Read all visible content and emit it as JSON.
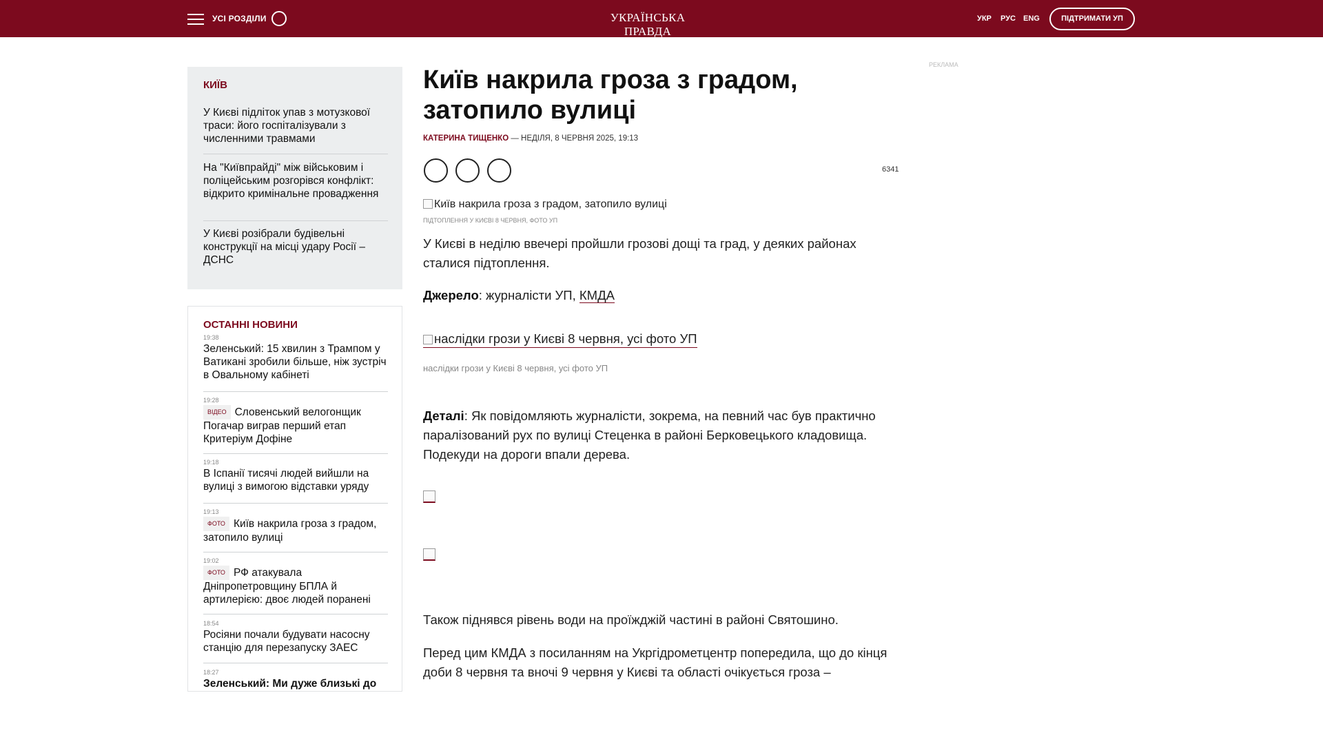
{
  "header": {
    "sections_label": "УСІ РОЗДІЛИ",
    "logo": "УКРАЇНСЬКА ПРАВДА",
    "languages": [
      "УКР",
      "РУС",
      "ENG"
    ],
    "support_label": "ПІДТРИМАТИ УП"
  },
  "sidebar_kyiv": {
    "title": "КИЇВ",
    "items": [
      "У Києві підліток упав з мотузкової траси: його госпіталізували з численними травмами",
      "На \"Київпрайді\" між військовим і поліцейським розгорівся конфлікт: відкрито кримінальне провадження",
      "У Києві розібрали будівельні конструкції на місці удару Росії – ДСНС"
    ]
  },
  "latest_news": {
    "title": "ОСТАННІ НОВИНИ",
    "items": [
      {
        "time": "19:38",
        "tag": "",
        "text": "Зеленський: 15 хвилин з Трампом у Ватикані зробили більше, ніж зустріч в Овальному кабінеті"
      },
      {
        "time": "19:28",
        "tag": "ВІДЕО",
        "text": "Словенський велогонщик Погачар виграв перший етап Критеріум Дофіне"
      },
      {
        "time": "19:18",
        "tag": "",
        "text": "В Іспанії тисячі людей вийшли на вулиці з вимогою відставки уряду"
      },
      {
        "time": "19:13",
        "tag": "ФОТО",
        "text": "Київ накрила гроза з градом, затопило вулиці"
      },
      {
        "time": "19:02",
        "tag": "ФОТО",
        "text": "РФ атакувала Дніпропетровщину БПЛА й артилерією: двоє людей поранені"
      },
      {
        "time": "18:54",
        "tag": "",
        "text": "Росіяни почали будувати насосну станцію для перезапуску ЗАЕС"
      },
      {
        "time": "18:27",
        "tag": "",
        "text": "Зеленський: Ми дуже близькі до"
      }
    ]
  },
  "article": {
    "headline": "Київ накрила гроза з градом, затопило вулиці",
    "author": "КАТЕРИНА ТИЩЕНКО",
    "date_sep": "—",
    "date": "НЕДІЛЯ, 8 ЧЕРВНЯ 2025, 19:13",
    "views": "6341",
    "main_image_alt": "Київ накрила гроза з градом, затопило вулиці",
    "main_image_caption": "підтоплення у Києві 8 червня, Фото УП",
    "lead": "У Києві в неділю ввечері пройшли грозові дощі та град, у деяких районах сталися підтоплення.",
    "source_label": "Джерело",
    "source_text": ": журналісти УП, ",
    "source_link": "КМДА",
    "photo_alt": "наслідки грози у Києві 8 червня, усі фото УП",
    "photo_caption": "наслідки грози у Києві 8 червня, усі фото УП",
    "details_label": "Деталі",
    "details_text": ": Як повідомляють журналісти, зокрема, на певний час був практично паралізований рух по вулиці Стеценка в районі Берковецького кладовища. Подекуди на дороги впали дерева.",
    "para_water": "Також піднявся рівень води на проїжджій частині в районі Святошино.",
    "para_forecast": "Перед цим КМДА з посиланням на Укргідрометцентр попередила, що до кінця доби 8 червня та вночі 9 червня у Києві та області очікується гроза –"
  },
  "ad_label": "Реклама"
}
